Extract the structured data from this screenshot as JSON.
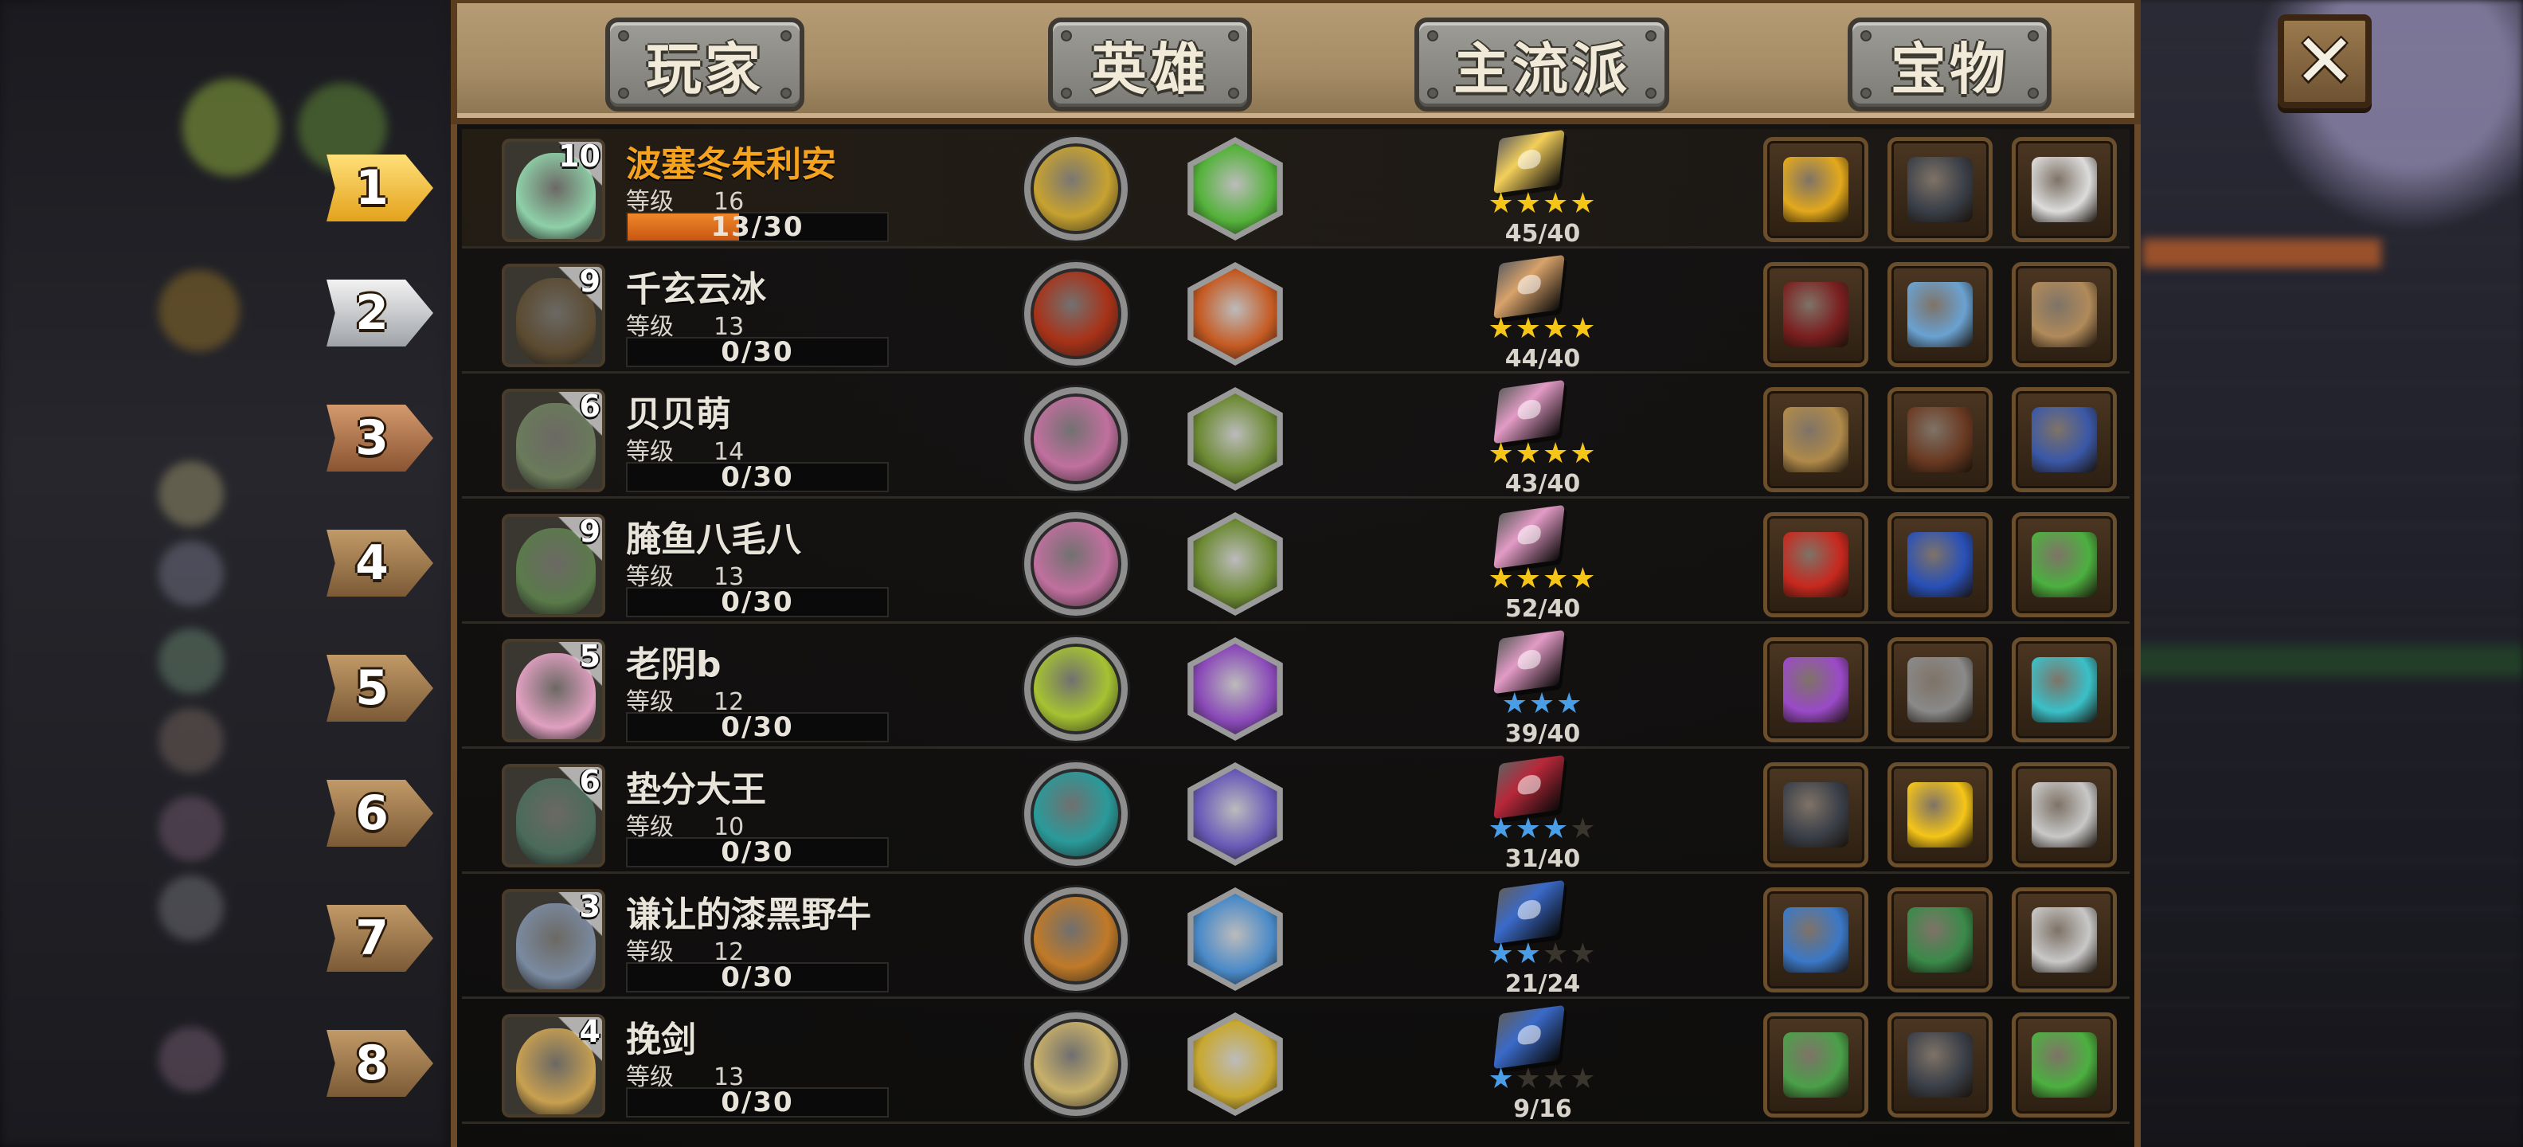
{
  "tabs": [
    "玩家",
    "英雄",
    "主流派",
    "宝物"
  ],
  "close_label": "✕",
  "level_label": "等级",
  "rows": [
    {
      "rank": "1",
      "rank_style": "gold",
      "avatar_level": "10",
      "name": "波塞冬朱利安",
      "name_highlight": true,
      "level": "16",
      "xp_current": "13",
      "xp_text": "13/30",
      "xp_fraction": 0.43,
      "hero_orb_color": "#c7a230",
      "hero_hex_color": "#54b23a",
      "book_color": "#f3cf5a",
      "stars_on": 4,
      "stars_total": 4,
      "star_color": "#f5c518",
      "progress": "45/40",
      "treasures": [
        "gold-bar",
        "pirate-hat",
        "silver-coin"
      ],
      "treasure_colors": [
        "#e3a91c",
        "#3a3f48",
        "#dcdcdc"
      ]
    },
    {
      "rank": "2",
      "rank_style": "silver",
      "avatar_level": "9",
      "name": "千玄云冰",
      "name_highlight": false,
      "level": "13",
      "xp_text": "0/30",
      "xp_fraction": 0,
      "hero_orb_color": "#a83218",
      "hero_hex_color": "#c55a22",
      "book_color": "#d8a26a",
      "stars_on": 4,
      "stars_total": 4,
      "star_color": "#f5c518",
      "progress": "44/40",
      "treasures": [
        "red-mask",
        "magic-staff",
        "ring"
      ],
      "treasure_colors": [
        "#7a1f1f",
        "#6aa2d2",
        "#b08a5a"
      ]
    },
    {
      "rank": "3",
      "rank_style": "bronze",
      "avatar_level": "6",
      "name": "贝贝萌",
      "name_highlight": false,
      "level": "14",
      "xp_text": "0/30",
      "xp_fraction": 0,
      "hero_orb_color": "#c0709e",
      "hero_hex_color": "#6d8a34",
      "book_color": "#e39bc6",
      "stars_on": 4,
      "stars_total": 4,
      "star_color": "#f5c518",
      "progress": "43/40",
      "treasures": [
        "scales",
        "leather-armor",
        "gift-box"
      ],
      "treasure_colors": [
        "#b08a4a",
        "#6a3a22",
        "#3a58a8"
      ]
    },
    {
      "rank": "4",
      "rank_style": "wood",
      "avatar_level": "9",
      "name": "腌鱼八毛八",
      "name_highlight": false,
      "level": "13",
      "xp_text": "0/30",
      "xp_fraction": 0,
      "hero_orb_color": "#c0709e",
      "hero_hex_color": "#6d8a34",
      "book_color": "#e39bc6",
      "stars_on": 4,
      "stars_total": 4,
      "star_color": "#f5c518",
      "progress": "52/40",
      "treasures": [
        "fire-ring",
        "blue-gem",
        "green-potion"
      ],
      "treasure_colors": [
        "#c8281e",
        "#2850b8",
        "#4cb040"
      ]
    },
    {
      "rank": "5",
      "rank_style": "wood",
      "avatar_level": "5",
      "name": "老阴b",
      "name_highlight": false,
      "level": "12",
      "xp_text": "0/30",
      "xp_fraction": 0,
      "hero_orb_color": "#a6c232",
      "hero_hex_color": "#8a4ab8",
      "book_color": "#e39bc6",
      "stars_on": 3,
      "stars_total": 3,
      "star_color": "#4a9ee8",
      "progress": "39/40",
      "treasures": [
        "purple-potion",
        "stone-ring",
        "cyan-rune"
      ],
      "treasure_colors": [
        "#9a4ac8",
        "#8a8a8a",
        "#3ac0c8"
      ]
    },
    {
      "rank": "6",
      "rank_style": "wood",
      "avatar_level": "6",
      "name": "垫分大王",
      "name_highlight": false,
      "level": "10",
      "xp_text": "0/30",
      "xp_fraction": 0,
      "hero_orb_color": "#2a9a9a",
      "hero_hex_color": "#6a5ab8",
      "book_color": "#b8283a",
      "stars_on": 3,
      "stars_total": 4,
      "star_color": "#4a9ee8",
      "progress": "31/40",
      "treasures": [
        "pirate-hat",
        "four-leaf-clover",
        "stone-statue"
      ],
      "treasure_colors": [
        "#3a3f48",
        "#f5c518",
        "#c8c8c8"
      ]
    },
    {
      "rank": "7",
      "rank_style": "wood",
      "avatar_level": "3",
      "name": "谦让的漆黑野牛",
      "name_highlight": false,
      "level": "12",
      "xp_text": "0/30",
      "xp_fraction": 0,
      "hero_orb_color": "#c07a28",
      "hero_hex_color": "#4a8ac8",
      "book_color": "#3a6ac8",
      "stars_on": 2,
      "stars_total": 4,
      "star_color": "#4a9ee8",
      "progress": "21/24",
      "treasures": [
        "compass",
        "fire-medallion",
        "stone-statue"
      ],
      "treasure_colors": [
        "#3a78c8",
        "#3a8a4a",
        "#c8c8c8"
      ]
    },
    {
      "rank": "8",
      "rank_style": "wood",
      "avatar_level": "4",
      "name": "挽剑",
      "name_highlight": false,
      "level": "13",
      "xp_text": "0/30",
      "xp_fraction": 0,
      "hero_orb_color": "#c8b06a",
      "hero_hex_color": "#c8a830",
      "book_color": "#3a6ac8",
      "stars_on": 1,
      "stars_total": 4,
      "star_color": "#4a9ee8",
      "progress": "9/16",
      "treasures": [
        "cactus-amulet",
        "pirate-hat",
        "green-potion"
      ],
      "treasure_colors": [
        "#4aa04a",
        "#3a3f48",
        "#4cb040"
      ]
    }
  ],
  "avatar_colors": [
    "#8ed0a8",
    "#5a4a30",
    "#6a7a5a",
    "#5a7a4a",
    "#e0a0c0",
    "#4a6a5a",
    "#7a8aa0",
    "#c8a050"
  ]
}
